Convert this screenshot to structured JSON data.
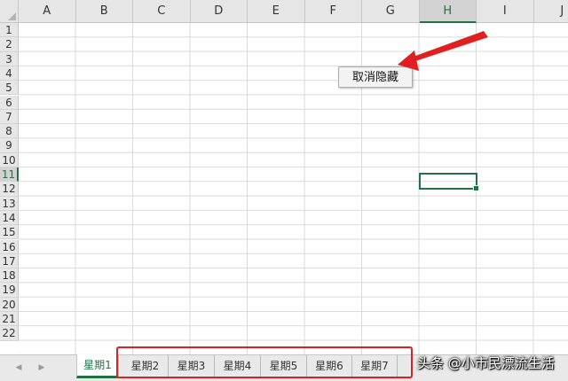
{
  "columns": [
    "A",
    "B",
    "C",
    "D",
    "E",
    "F",
    "G",
    "H",
    "I",
    "J"
  ],
  "active_column": "H",
  "rows": [
    "1",
    "2",
    "3",
    "4",
    "5",
    "6",
    "7",
    "8",
    "9",
    "10",
    "11",
    "12",
    "13",
    "14",
    "15",
    "16",
    "17",
    "18",
    "19",
    "20",
    "21",
    "22"
  ],
  "active_row": "11",
  "selected_cell": "H11",
  "float_button": {
    "label": "取消隐藏"
  },
  "tabs": [
    "星期1",
    "星期2",
    "星期3",
    "星期4",
    "星期5",
    "星期6",
    "星期7"
  ],
  "active_tab": "星期1",
  "tab_nav": {
    "prev": "◀",
    "next": "▶"
  },
  "watermark": "头条 @小市民漂流生活",
  "colors": {
    "accent": "#217346",
    "annotation": "#e02020"
  }
}
